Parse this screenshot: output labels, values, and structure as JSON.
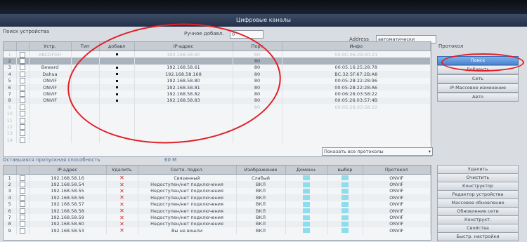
{
  "window": {
    "title": "Цифровые каналы"
  },
  "search_panel": {
    "caption": "Поиск устройства",
    "manual_label": "Ручное добавл.",
    "manual_value": "0",
    "address_label": "Address",
    "address_value": "автоматически"
  },
  "device_table": {
    "columns": [
      "",
      "",
      "Устр. ",
      "Тип",
      "добавл",
      "IP-адрес",
      "Порт",
      "Инфо"
    ],
    "rows": [
      {
        "no": "1",
        "name": "ABCDFGH",
        "ip": "192.168.58.60",
        "port": "80",
        "info": "00:0C:06:29:00:21",
        "state": "dim"
      },
      {
        "no": "2",
        "name": "",
        "ip": "",
        "port": "80",
        "info": "",
        "state": "sel"
      },
      {
        "no": "3",
        "name": "Beward",
        "ip": "192.168.58.61",
        "port": "80",
        "info": "00:05:16:25:28:78",
        "state": ""
      },
      {
        "no": "4",
        "name": "Dahua",
        "ip": "192.168.58.168",
        "port": "80",
        "info": "BC:32:5F:67:2B:A8",
        "state": ""
      },
      {
        "no": "5",
        "name": "ONVIF",
        "ip": "192.168.58.80",
        "port": "80",
        "info": "00:05:28:22:28:96",
        "state": ""
      },
      {
        "no": "6",
        "name": "ONVIF",
        "ip": "192.168.58.81",
        "port": "80",
        "info": "00:05:28:22:28:A6",
        "state": ""
      },
      {
        "no": "7",
        "name": "ONVIF",
        "ip": "192.168.58.82",
        "port": "80",
        "info": "00:06:26:03:58:22",
        "state": ""
      },
      {
        "no": "8",
        "name": "ONVIF",
        "ip": "192.168.58.83",
        "port": "80",
        "info": "00:05:26:03:57:4B",
        "state": ""
      },
      {
        "no": "9",
        "name": "",
        "ip": "",
        "port": "80",
        "info": "00:05:26:03:58:22",
        "state": "dim"
      },
      {
        "no": "10",
        "name": "",
        "ip": "",
        "port": "",
        "info": "",
        "state": "dim"
      },
      {
        "no": "11",
        "name": "",
        "ip": "",
        "port": "",
        "info": "",
        "state": "dim"
      },
      {
        "no": "12",
        "name": "",
        "ip": "",
        "port": "",
        "info": "",
        "state": "dim"
      },
      {
        "no": "13",
        "name": "",
        "ip": "",
        "port": "",
        "info": "",
        "state": "dim"
      },
      {
        "no": "14",
        "name": "",
        "ip": "",
        "port": "",
        "info": "",
        "state": "dim"
      }
    ]
  },
  "side_top": {
    "protocol_label": "Протокол",
    "buttons": [
      "Поиск",
      "Добавить",
      "Сеть",
      "IP-Массовое изменение",
      "Авто"
    ]
  },
  "filter_dropdown": "Показать все протоколы",
  "bandwidth": {
    "label": "Оставшаяся пропускная способность",
    "value": "60 M"
  },
  "channel_table": {
    "columns": [
      "",
      "",
      "IP-адрес",
      "Удалить",
      "Состо. подкл.",
      "Изображение",
      "Доменн.",
      "выбор",
      "Протокол"
    ],
    "rows": [
      {
        "no": "1",
        "ip": "192.168.58.16",
        "status": "Связанный",
        "image": "Слабый",
        "proto": "ONVIF"
      },
      {
        "no": "2",
        "ip": "192.168.58.54",
        "status": "Недоступен/нет подключения",
        "image": "ВКЛ",
        "proto": "ONVIF"
      },
      {
        "no": "3",
        "ip": "192.168.58.55",
        "status": "Недоступен/нет подключения",
        "image": "ВКЛ",
        "proto": "ONVIF"
      },
      {
        "no": "4",
        "ip": "192.168.58.56",
        "status": "Недоступен/нет подключения",
        "image": "ВКЛ",
        "proto": "ONVIF"
      },
      {
        "no": "5",
        "ip": "192.168.58.57",
        "status": "Недоступен/нет подключения",
        "image": "ВКЛ",
        "proto": "ONVIF"
      },
      {
        "no": "6",
        "ip": "192.168.58.58",
        "status": "Недоступен/нет подключения",
        "image": "ВКЛ",
        "proto": "ONVIF"
      },
      {
        "no": "7",
        "ip": "192.168.58.59",
        "status": "Недоступен/нет подключения",
        "image": "ВКЛ",
        "proto": "ONVIF"
      },
      {
        "no": "8",
        "ip": "192.168.58.60",
        "status": "Недоступен/нет подключения",
        "image": "ВКЛ",
        "proto": "ONVIF"
      },
      {
        "no": "9",
        "ip": "192.168.58.53",
        "status": "Вы не вошли",
        "image": "ВКЛ",
        "proto": "ONVIF"
      }
    ]
  },
  "side_bottom": {
    "buttons": [
      "Удалить",
      "Очистить",
      "Конструктор",
      "Редактор устройства",
      "Массовое обновление",
      "Обновление сети",
      "Конструкт.",
      "Свойства",
      "Быстр. настройки"
    ]
  },
  "annotation_color": "#e02028",
  "icons": {
    "checkbox": "checkbox-icon",
    "delete": "red-x-icon",
    "added": "dot-icon",
    "dropdown": "chevron-down-icon"
  }
}
